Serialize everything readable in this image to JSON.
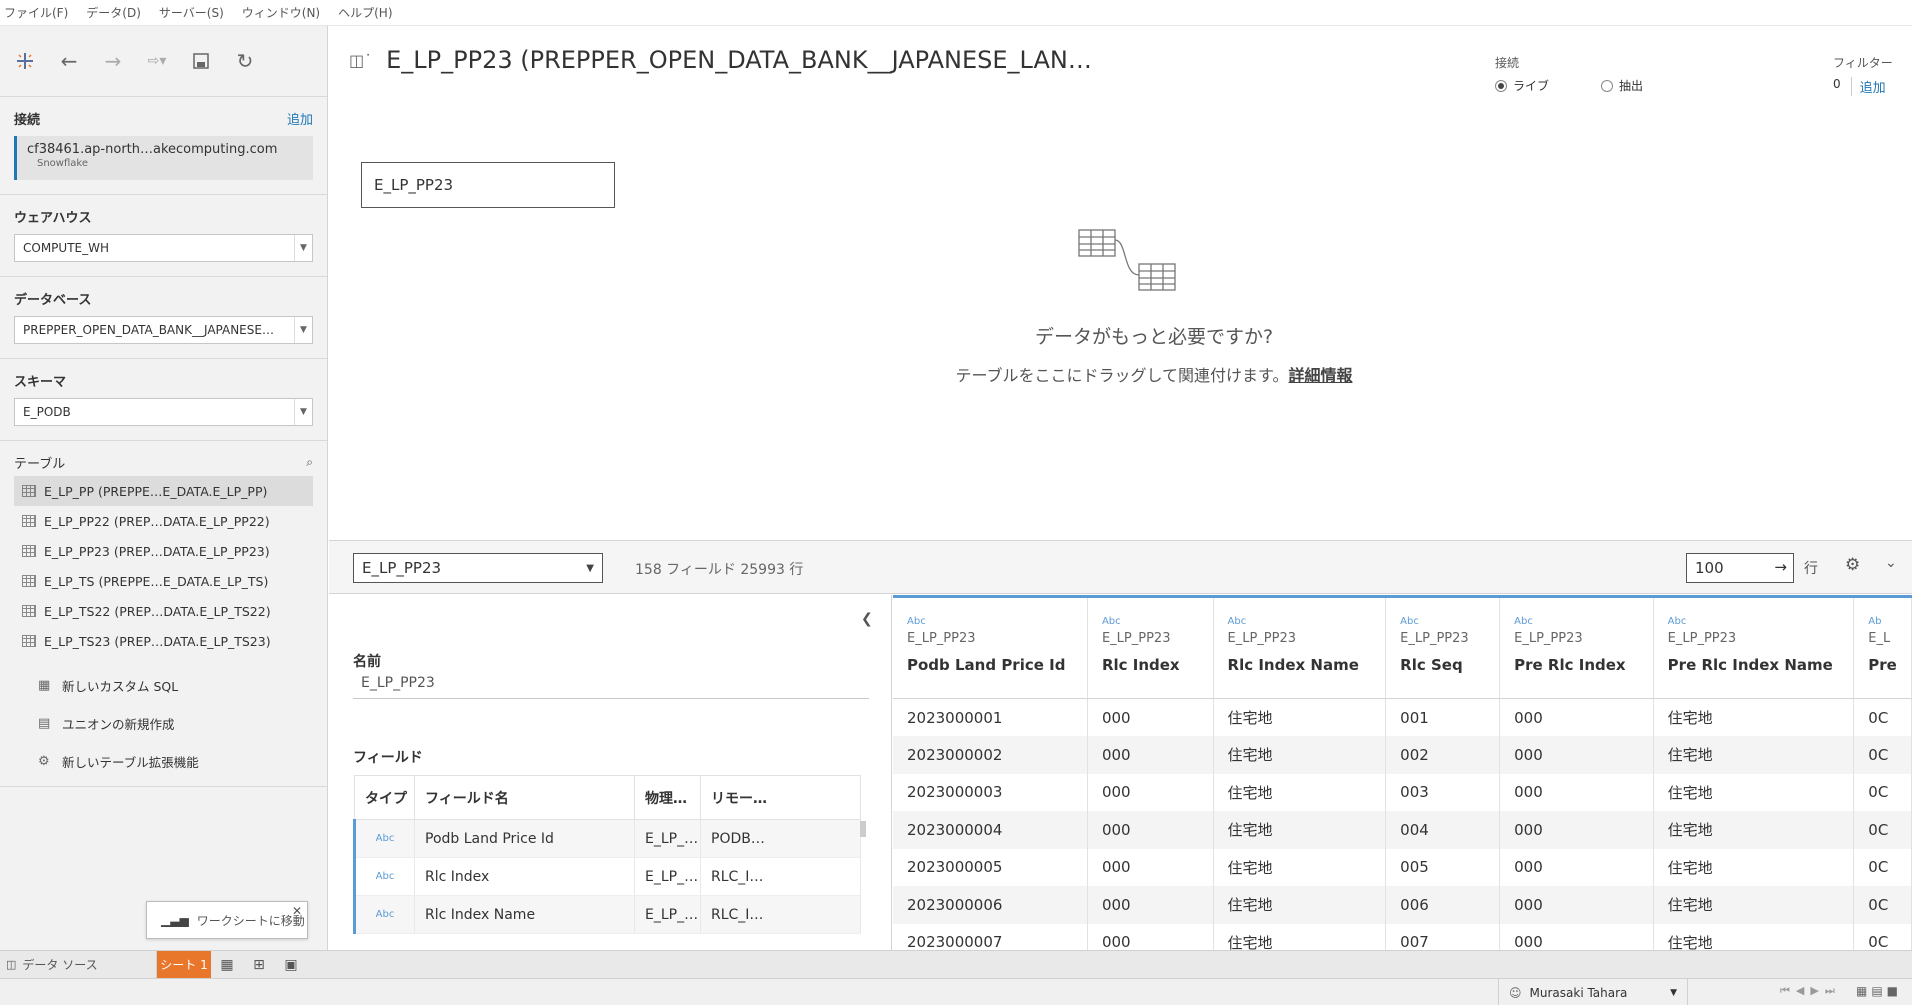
{
  "menu": [
    "ファイル(F)",
    "データ(D)",
    "サーバー(S)",
    "ウィンドウ(N)",
    "ヘルプ(H)"
  ],
  "sidebar": {
    "connection": {
      "title": "接続",
      "add": "追加",
      "name": "cf38461.ap-north…akecomputing.com",
      "type": "Snowflake"
    },
    "warehouse": {
      "title": "ウェアハウス",
      "value": "COMPUTE_WH"
    },
    "database": {
      "title": "データベース",
      "value": "PREPPER_OPEN_DATA_BANK__JAPANESE…"
    },
    "schema": {
      "title": "スキーマ",
      "value": "E_PODB"
    },
    "tables": {
      "title": "テーブル",
      "items": [
        "E_LP_PP (PREPPE…E_DATA.E_LP_PP)",
        "E_LP_PP22 (PREP…DATA.E_LP_PP22)",
        "E_LP_PP23 (PREP…DATA.E_LP_PP23)",
        "E_LP_TS (PREPPE…E_DATA.E_LP_TS)",
        "E_LP_TS22 (PREP…DATA.E_LP_TS22)",
        "E_LP_TS23 (PREP…DATA.E_LP_TS23)"
      ],
      "extras": [
        "新しいカスタム SQL",
        "ユニオンの新規作成",
        "新しいテーブル拡張機能"
      ]
    }
  },
  "tooltip": "ワークシートに移動",
  "canvas": {
    "title": "E_LP_PP23 (PREPPER_OPEN_DATA_BANK__JAPANESE_LAN…",
    "connection_label": "接続",
    "live": "ライブ",
    "extract": "抽出",
    "filter_label": "フィルター",
    "filter_count": "0",
    "filter_add": "追加",
    "table_node": "E_LP_PP23",
    "empty_msg": "データがもっと必要ですか?",
    "empty_sub": "テーブルをここにドラッグして関連付けます。",
    "more_info": "詳細情報"
  },
  "gridbar": {
    "table": "E_LP_PP23",
    "info": "158 フィールド 25993 行",
    "rows": "100",
    "rows_label": "行"
  },
  "meta": {
    "name_label": "名前",
    "name_value": "E_LP_PP23",
    "fields_label": "フィールド",
    "headers": [
      "タイプ",
      "フィールド名",
      "物理…",
      "リモー…"
    ],
    "rows": [
      [
        "Abc",
        "Podb Land Price Id",
        "E_LP_…",
        "PODB…"
      ],
      [
        "Abc",
        "Rlc Index",
        "E_LP_…",
        "RLC_I…"
      ],
      [
        "Abc",
        "Rlc Index Name",
        "E_LP_…",
        "RLC_I…"
      ]
    ]
  },
  "grid": {
    "columns": [
      {
        "type": "Abc",
        "source": "E_LP_PP23",
        "name": "Podb Land Price Id"
      },
      {
        "type": "Abc",
        "source": "E_LP_PP23",
        "name": "Rlc Index"
      },
      {
        "type": "Abc",
        "source": "E_LP_PP23",
        "name": "Rlc Index Name"
      },
      {
        "type": "Abc",
        "source": "E_LP_PP23",
        "name": "Rlc Seq"
      },
      {
        "type": "Abc",
        "source": "E_LP_PP23",
        "name": "Pre Rlc Index"
      },
      {
        "type": "Abc",
        "source": "E_LP_PP23",
        "name": "Pre Rlc Index Name"
      },
      {
        "type": "Ab",
        "source": "E_L",
        "name": "Pre"
      }
    ],
    "rows": [
      [
        "2023000001",
        "000",
        "住宅地",
        "001",
        "000",
        "住宅地",
        "0C"
      ],
      [
        "2023000002",
        "000",
        "住宅地",
        "002",
        "000",
        "住宅地",
        "0C"
      ],
      [
        "2023000003",
        "000",
        "住宅地",
        "003",
        "000",
        "住宅地",
        "0C"
      ],
      [
        "2023000004",
        "000",
        "住宅地",
        "004",
        "000",
        "住宅地",
        "0C"
      ],
      [
        "2023000005",
        "000",
        "住宅地",
        "005",
        "000",
        "住宅地",
        "0C"
      ],
      [
        "2023000006",
        "000",
        "住宅地",
        "006",
        "000",
        "住宅地",
        "0C"
      ],
      [
        "2023000007",
        "000",
        "住宅地",
        "007",
        "000",
        "住宅地",
        "0C"
      ]
    ]
  },
  "bottom": {
    "datasource_tab": "データ ソース",
    "sheet_tab": "シート 1",
    "user": "Murasaki Tahara"
  }
}
